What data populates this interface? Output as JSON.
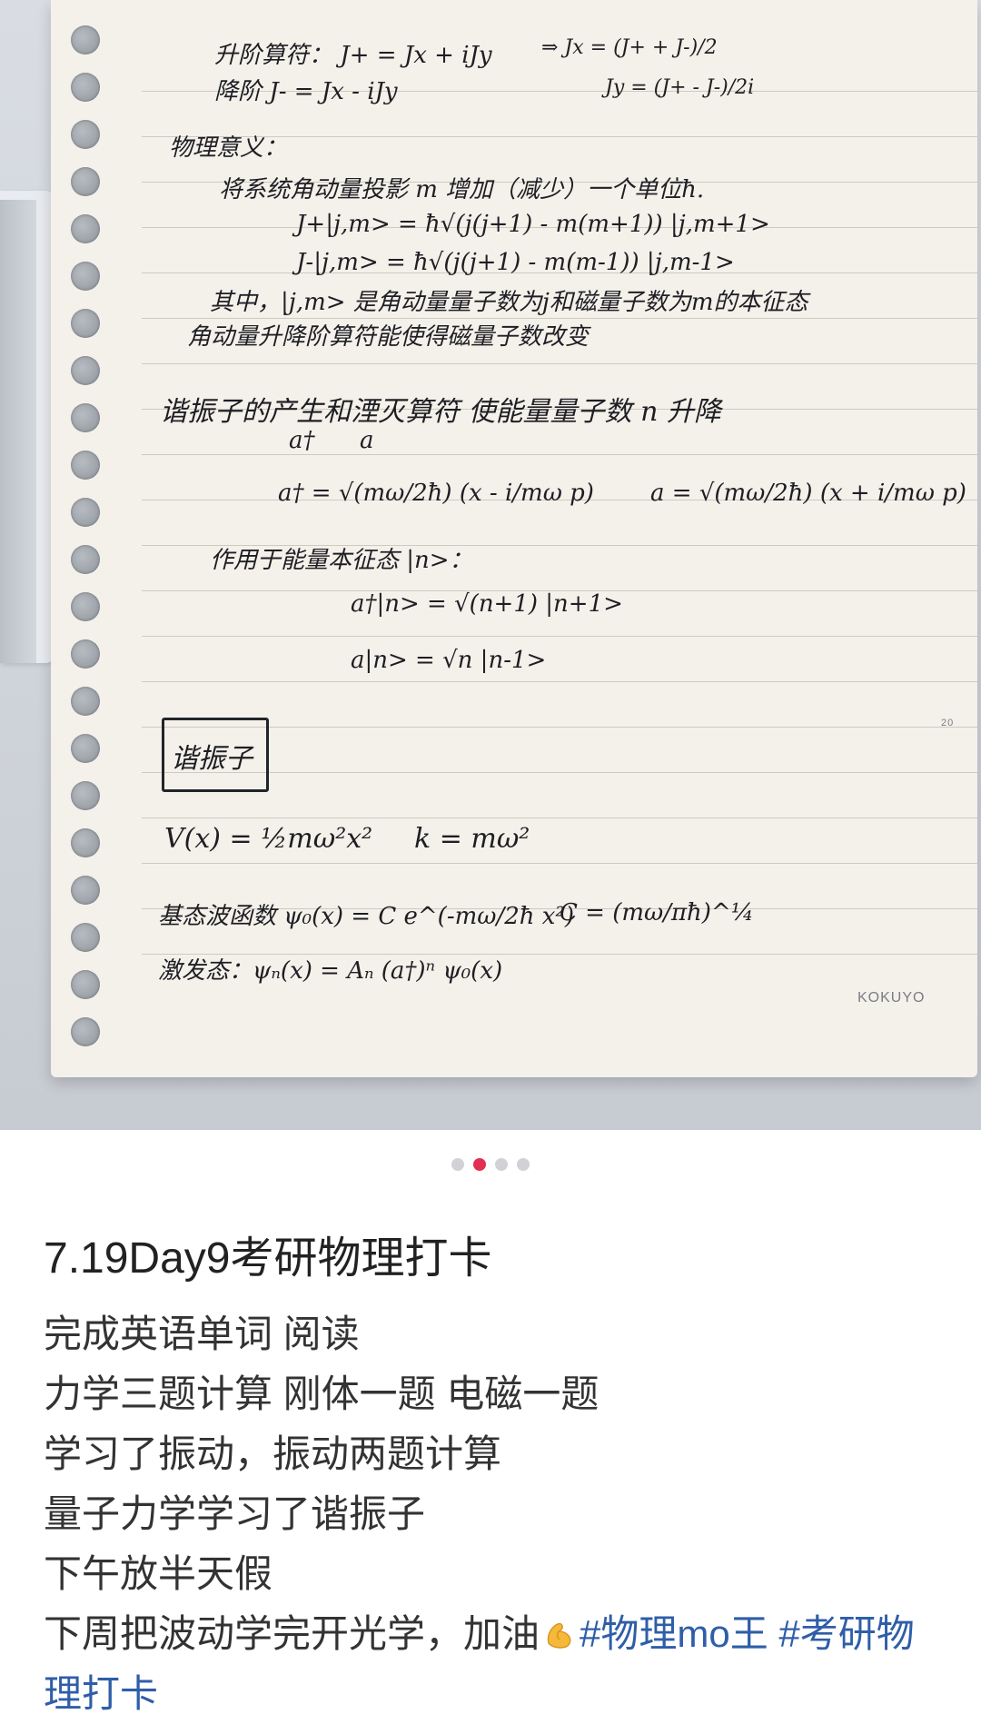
{
  "carousel": {
    "dot_count": 4,
    "active_index": 1,
    "active_color": "#e33050",
    "inactive_color": "#d2d2d6"
  },
  "notebook": {
    "brand": "KOKUYO",
    "margin_number": "20",
    "lines": {
      "raising": "升阶算符： J+ = Jx + iJy",
      "lowering": "降阶 J- = Jx - iJy",
      "jx": "⇒ Jx = (J+ + J-)/2",
      "jy": "Jy = (J+ - J-)/2i",
      "phys_title": "物理意义：",
      "phys_desc": "将系统角动量投影 m 增加（减少）一个单位ħ.",
      "jplus": "J+|j,m> = ħ√(j(j+1) - m(m+1)) |j,m+1>",
      "jminus": "J-|j,m> = ħ√(j(j+1) - m(m-1)) |j,m-1>",
      "where": "其中，|j,m> 是角动量量子数为j和磁量子数为m的本征态",
      "ladder_note": "角动量升降阶算符能使得磁量子数改变",
      "osc_ops": "谐振子的产生和湮灭算符   使能量量子数 n 升降",
      "a_dag_lbl": "a†",
      "a_lbl": "a",
      "a_dag_def": "a† = √(mω/2ħ) (x - i/mω p)",
      "a_def": "a = √(mω/2ħ) (x + i/mω p)",
      "acts_on": "作用于能量本征态 |n>：",
      "a_dag_n": "a†|n> = √(n+1) |n+1>",
      "a_n": "a|n> = √n |n-1>",
      "box_title": "谐振子",
      "potential": "V(x) = ½mω²x²",
      "k_def": "k = mω²",
      "ground": "基态波函数 ψ₀(x) = C e^(-mω/2ħ x²)",
      "c_def": "C = (mω/πħ)^¼",
      "excited": "激发态：ψₙ(x) = Aₙ (a†)ⁿ ψ₀(x)"
    }
  },
  "post": {
    "title": "7.19Day9考研物理打卡",
    "lines": [
      "完成英语单词 阅读",
      "力学三题计算 刚体一题 电磁一题",
      "学习了振动，振动两题计算",
      "量子力学学习了谐振子",
      "下午放半天假"
    ],
    "last_line_text": "下周把波动学完开光学，加油",
    "emoji": "flexed-biceps-icon",
    "tags": [
      "#物理mo王",
      "#考研物理打卡"
    ]
  }
}
